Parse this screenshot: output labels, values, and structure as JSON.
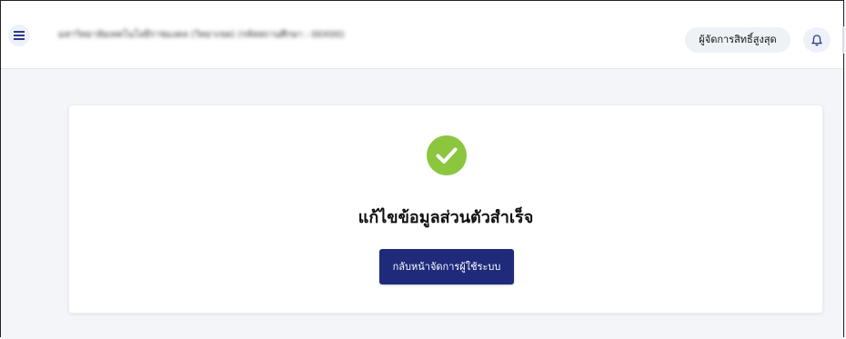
{
  "header": {
    "org_name": "มหาวิทยาลัยเทคโนโลยีราชมงคล (วิทยาเขต) (รหัสสถานศึกษา : 00X00)",
    "role_label": "ผู้จัดการสิทธิ์สูงสุด",
    "menu_icon": "menu-icon",
    "notification_icon": "bell-icon"
  },
  "result": {
    "icon": "check-circle-icon",
    "title": "แก้ไขข้อมูลส่วนตัวสำเร็จ",
    "button_label": "กลับหน้าจัดการผู้ใช้ระบบ"
  },
  "colors": {
    "success": "#8cc63f",
    "primary_button": "#1f2b7a",
    "background": "#f3f5f9"
  }
}
